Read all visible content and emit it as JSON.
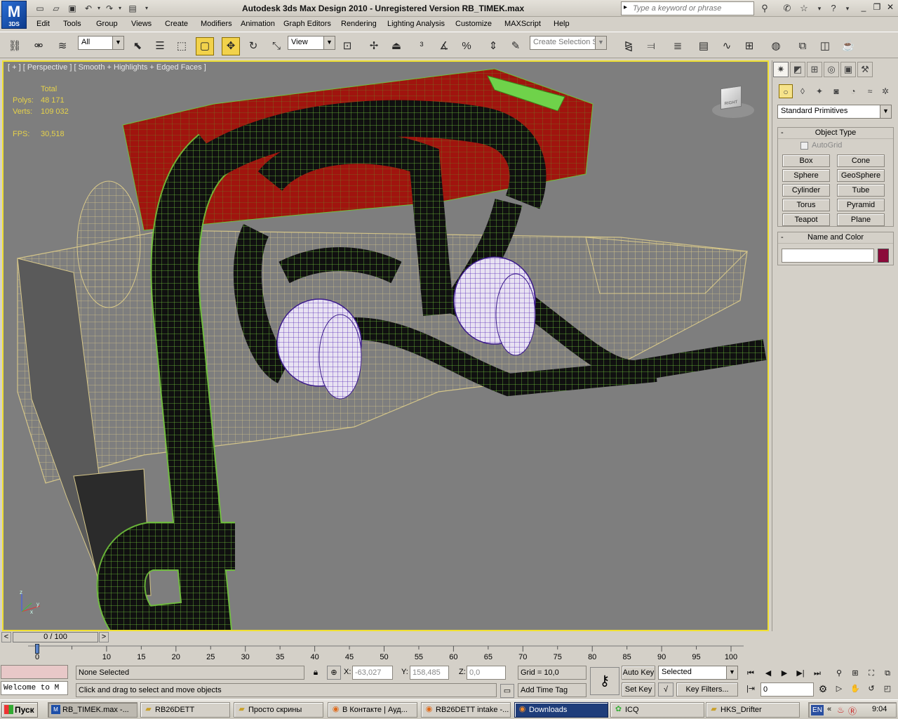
{
  "app": {
    "logo_text": "3DS",
    "title": "Autodesk 3ds Max Design 2010  -  Unregistered Version    RB_TIMEK.max",
    "search_placeholder": "Type a keyword or phrase"
  },
  "menu": [
    "Edit",
    "Tools",
    "Group",
    "Views",
    "Create",
    "Modifiers",
    "Animation",
    "Graph Editors",
    "Rendering",
    "Lighting Analysis",
    "Customize",
    "MAXScript",
    "Help"
  ],
  "toolbar": {
    "selection_filter": "All",
    "ref_coord": "View",
    "named_selection_placeholder": "Create Selection Se"
  },
  "viewport": {
    "label": "[ + ] [ Perspective ] [ Smooth + Highlights + Edged Faces ]",
    "stats": {
      "total_label": "Total",
      "polys_label": "Polys:",
      "polys_value": "48 171",
      "verts_label": "Verts:",
      "verts_value": "109 032",
      "fps_label": "FPS:",
      "fps_value": "30,518"
    },
    "viewcube_face": "RIGHT",
    "axis": {
      "x": "x",
      "y": "y",
      "z": "z"
    }
  },
  "command_panel": {
    "category": "Standard Primitives",
    "object_type_title": "Object Type",
    "autogrid_label": "AutoGrid",
    "primitives": [
      "Box",
      "Cone",
      "Sphere",
      "GeoSphere",
      "Cylinder",
      "Tube",
      "Torus",
      "Pyramid",
      "Teapot",
      "Plane"
    ],
    "name_color_title": "Name and Color",
    "name_value": "",
    "color": "#8b0a3a"
  },
  "timeline": {
    "slider_label": "0 / 100",
    "ticks": [
      "0",
      "10",
      "15",
      "20",
      "25",
      "30",
      "35",
      "40",
      "45",
      "50",
      "55",
      "60",
      "65",
      "70",
      "75",
      "80",
      "85",
      "90",
      "95",
      "100"
    ],
    "prev_label": "<",
    "next_label": ">"
  },
  "status": {
    "maxscript_listener": "Welcome to M",
    "selection_info": "None Selected",
    "prompt": "Click and drag to select and move objects",
    "x_label": "X:",
    "x_value": "-63,027",
    "y_label": "Y:",
    "y_value": "158,485",
    "z_label": "Z:",
    "z_value": "0,0",
    "grid": "Grid = 10,0",
    "add_time_tag": "Add Time Tag",
    "auto_key": "Auto Key",
    "set_key": "Set Key",
    "key_mode": "Selected",
    "key_filters": "Key Filters...",
    "current_frame": "0"
  },
  "taskbar": {
    "start": "Пуск",
    "tasks": [
      {
        "label": "RB_TIMEK.max -...",
        "icon": "3ds-max-icon",
        "active": true
      },
      {
        "label": "RB26DETT",
        "icon": "folder-icon",
        "active": false
      },
      {
        "label": "Просто скрины",
        "icon": "folder-icon",
        "active": false
      },
      {
        "label": "В Контакте | Ауд...",
        "icon": "firefox-icon",
        "active": false
      },
      {
        "label": "RB26DETT intake -...",
        "icon": "firefox-icon",
        "active": false
      },
      {
        "label": "Downloads",
        "icon": "firefox-icon",
        "active": false
      },
      {
        "label": "ICQ",
        "icon": "icq-icon",
        "active": false
      },
      {
        "label": "HKS_Drifter",
        "icon": "folder-icon",
        "active": false
      }
    ],
    "lang": "EN",
    "clock": "9:04"
  }
}
